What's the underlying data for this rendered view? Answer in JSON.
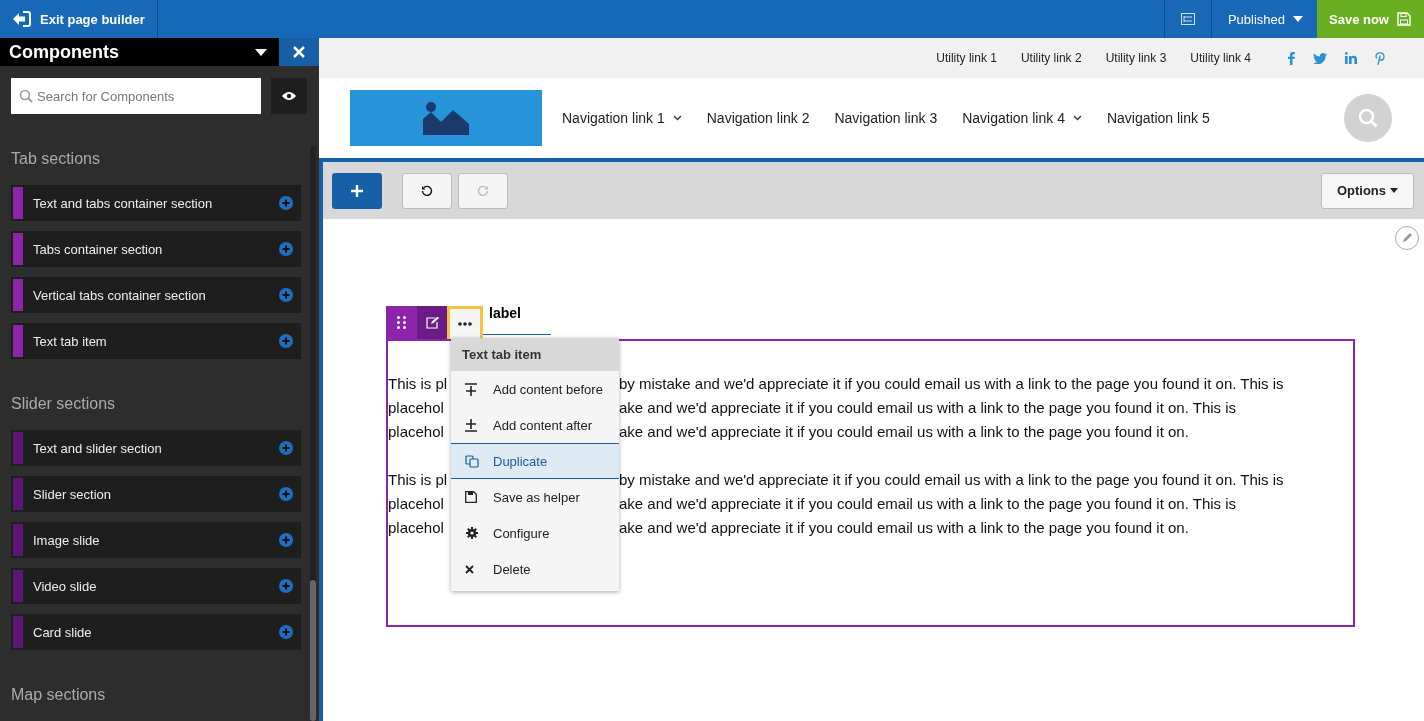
{
  "topbar": {
    "exit": "Exit page builder",
    "status": "Published",
    "save": "Save now"
  },
  "sidebar": {
    "title": "Components",
    "search": {
      "placeholder": "Search for Components"
    },
    "groups": [
      {
        "title": "Tab sections",
        "items": [
          {
            "label": "Text and tabs container section",
            "color": "#8e24aa"
          },
          {
            "label": "Tabs container section",
            "color": "#8e24aa"
          },
          {
            "label": "Vertical tabs container section",
            "color": "#8e24aa"
          },
          {
            "label": "Text tab item",
            "color": "#8e24aa"
          }
        ]
      },
      {
        "title": "Slider sections",
        "items": [
          {
            "label": "Text and slider section",
            "color": "#5e1575"
          },
          {
            "label": "Slider section",
            "color": "#5e1575"
          },
          {
            "label": "Image slide",
            "color": "#5e1575"
          },
          {
            "label": "Video slide",
            "color": "#5e1575"
          },
          {
            "label": "Card slide",
            "color": "#5e1575"
          }
        ]
      },
      {
        "title": "Map sections"
      }
    ]
  },
  "site": {
    "utility_links": [
      "Utility link 1",
      "Utility link 2",
      "Utility link 3",
      "Utility link 4"
    ],
    "social": [
      {
        "kind": "facebook"
      },
      {
        "kind": "twitter"
      },
      {
        "kind": "linkedin"
      },
      {
        "kind": "pinterest"
      }
    ],
    "nav": [
      {
        "label": "Navigation link 1",
        "dropdown": true
      },
      {
        "label": "Navigation link 2",
        "dropdown": false
      },
      {
        "label": "Navigation link 3",
        "dropdown": false
      },
      {
        "label": "Navigation link 4",
        "dropdown": true
      },
      {
        "label": "Navigation link 5",
        "dropdown": false
      }
    ]
  },
  "editor": {
    "options": "Options",
    "undo_disabled": false,
    "redo_disabled": true,
    "tab_label": "label",
    "paragraphs": [
      [
        {
          "left": "This is pl",
          "right": "by mistake and we'd appreciate it if you could email us with a link to the page you found it on. This is"
        },
        {
          "left": "placehol",
          "right": "ake and we'd appreciate it if you could email us with a link to the page you found it on. This is"
        },
        {
          "left": "placehol",
          "right": "ake and we'd appreciate it if you could email us with a link to the page you found it on."
        }
      ],
      [
        {
          "left": "This is pl",
          "right": "by mistake and we'd appreciate it if you could email us with a link to the page you found it on. This is"
        },
        {
          "left": "placehol",
          "right": "ake and we'd appreciate it if you could email us with a link to the page you found it on. This is"
        },
        {
          "left": "placehol",
          "right": "ake and we'd appreciate it if you could email us with a link to the page you found it on."
        }
      ]
    ],
    "menu": {
      "title": "Text tab item",
      "items": [
        {
          "label": "Add content before",
          "kind": "add-before",
          "selected": false
        },
        {
          "label": "Add content after",
          "kind": "add-after",
          "selected": false
        },
        {
          "label": "Duplicate",
          "kind": "duplicate",
          "selected": true
        },
        {
          "label": "Save as helper",
          "kind": "save",
          "selected": false
        },
        {
          "label": "Configure",
          "kind": "configure",
          "selected": false
        },
        {
          "label": "Delete",
          "kind": "delete",
          "selected": false
        }
      ]
    }
  }
}
